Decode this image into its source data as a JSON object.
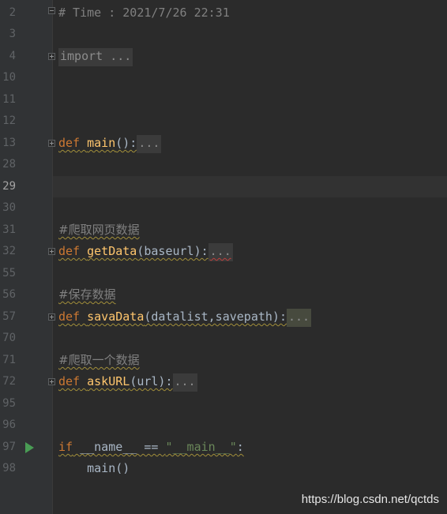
{
  "lines": {
    "l2": {
      "num": "2",
      "text": "# Time : 2021/7/26 22:31"
    },
    "l3": {
      "num": "3"
    },
    "l4": {
      "num": "4",
      "kw": "import",
      "dots": " ..."
    },
    "l10": {
      "num": "10"
    },
    "l11": {
      "num": "11"
    },
    "l12": {
      "num": "12"
    },
    "l13": {
      "num": "13",
      "kw": "def",
      "name": "main",
      "args": "():",
      "dots": "..."
    },
    "l28": {
      "num": "28"
    },
    "l29": {
      "num": "29"
    },
    "l30": {
      "num": "30"
    },
    "l31": {
      "num": "31",
      "text": "#爬取网页数据"
    },
    "l32": {
      "num": "32",
      "kw": "def",
      "name": "getData",
      "args": "(baseurl):",
      "dots": "..."
    },
    "l55": {
      "num": "55"
    },
    "l56": {
      "num": "56",
      "text": "#保存数据"
    },
    "l57": {
      "num": "57",
      "kw": "def",
      "name": "savaData",
      "args": "(datalist,savepath):",
      "dots": "..."
    },
    "l70": {
      "num": "70"
    },
    "l71": {
      "num": "71",
      "text": "#爬取一个数据"
    },
    "l72": {
      "num": "72",
      "kw": "def",
      "name": "askURL",
      "args": "(url):",
      "dots": "..."
    },
    "l95": {
      "num": "95"
    },
    "l96": {
      "num": "96"
    },
    "l97": {
      "num": "97",
      "kw": "if",
      "cond": " __name__ == ",
      "str": "\"__main__\"",
      "colon": ":"
    },
    "l98": {
      "num": "98",
      "text": "    main()"
    }
  },
  "watermark": "https://blog.csdn.net/qctds",
  "colors": {
    "background": "#2b2b2b",
    "gutter": "#313335",
    "keyword": "#cc7832",
    "function": "#ffc66d",
    "comment": "#808080",
    "string": "#6a8759",
    "text": "#a9b7c6",
    "run_icon": "#499c54"
  },
  "icons": {
    "run": "run-arrow-icon",
    "fold": "fold-marker-icon"
  }
}
